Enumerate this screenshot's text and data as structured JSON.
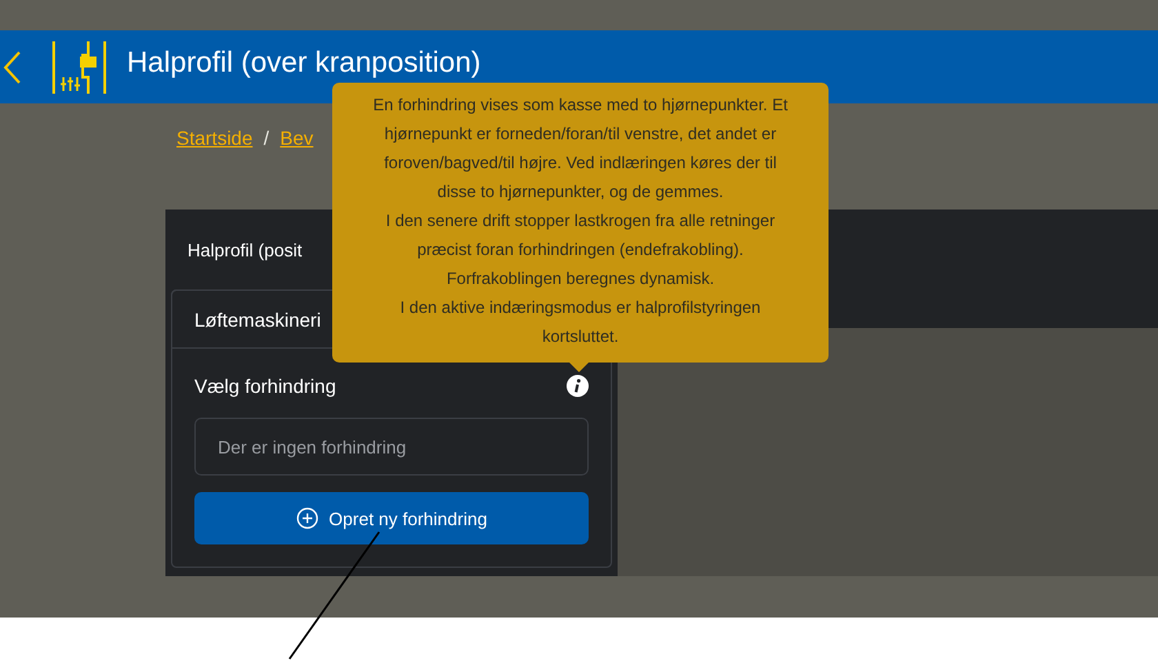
{
  "header": {
    "title": "Halprofil (over kranposition)"
  },
  "breadcrumb": [
    {
      "label": "Startside",
      "kind": "link"
    },
    {
      "label": "/",
      "kind": "separator"
    },
    {
      "label": "Bev",
      "kind": "link"
    }
  ],
  "panel": {
    "title": "Halprofil (posit",
    "tabs": [
      {
        "label": "Løftemaskineri",
        "selected": true
      }
    ],
    "field_label": "Vælg forhindring",
    "field": {
      "placeholder": "Der er ingen forhindring"
    },
    "button": "Opret ny forhindring"
  },
  "tooltip": {
    "lines": [
      "En forhindring vises som kasse med to hjørnepunkter. Et hjørnepunkt er forneden/foran/til venstre, det andet er foroven/bagved/til højre. Ved indlæringen køres der til disse to hjørnepunkter, og de gemmes.",
      "I den senere drift stopper lastkrogen fra alle retninger præcist foran forhindringen (endefrakobling).",
      "Forfrakoblingen beregnes dynamisk.",
      "I den aktive indæringsmodus er halprofilstyringen kortsluttet."
    ]
  }
}
